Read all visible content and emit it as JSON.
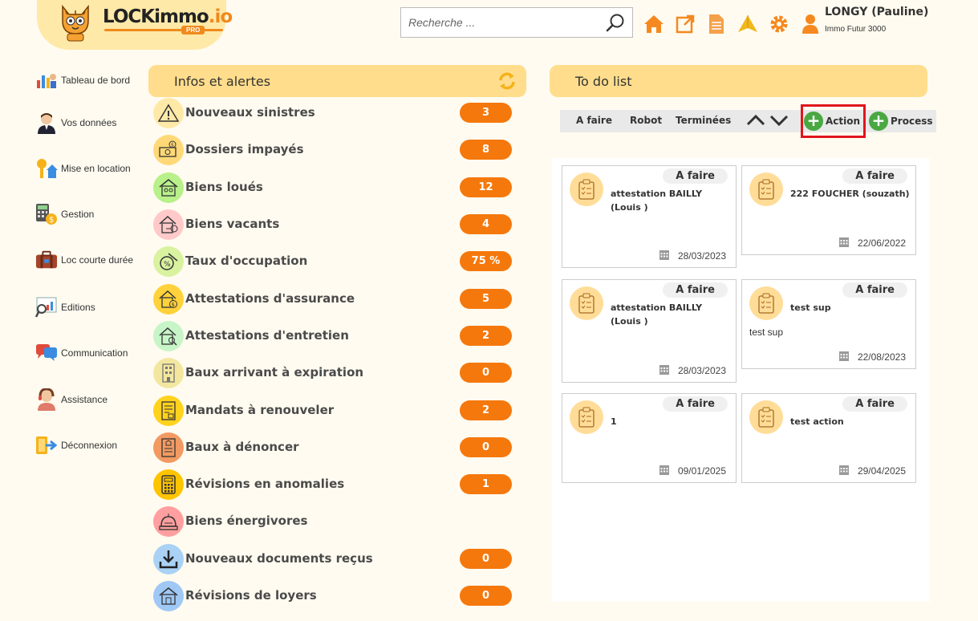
{
  "header": {
    "logo_text": "LOCKimmo",
    "logo_suffix": ".io",
    "logo_badge": "PRO",
    "search_placeholder": "Recherche ...",
    "user_name": "LONGY (Pauline)",
    "user_company": "Immo Futur 3000",
    "icons": [
      "home-icon",
      "external-link-icon",
      "document-icon",
      "paper-plane-icon",
      "gear-icon",
      "user-icon"
    ],
    "accent_color": "#f08a1c"
  },
  "sidebar": {
    "items": [
      {
        "label": "Tableau de bord",
        "icon": "dashboard-icon"
      },
      {
        "label": "Vos données",
        "icon": "person-icon"
      },
      {
        "label": "Mise en location",
        "icon": "key-house-icon"
      },
      {
        "label": "Gestion",
        "icon": "calculator-money-icon"
      },
      {
        "label": "Loc courte durée",
        "icon": "suitcase-icon"
      },
      {
        "label": "Editions",
        "icon": "chart-search-icon"
      },
      {
        "label": "Communication",
        "icon": "chat-bubbles-icon"
      },
      {
        "label": "Assistance",
        "icon": "support-agent-icon"
      },
      {
        "label": "Déconnexion",
        "icon": "logout-icon"
      }
    ]
  },
  "infos": {
    "title": "Infos et alertes",
    "badge_color": "#f5780c",
    "rows": [
      {
        "label": "Nouveaux sinistres",
        "count": "3",
        "icon": "warning-icon",
        "bg": "#ffe9a8"
      },
      {
        "label": "Dossiers impayés",
        "count": "8",
        "icon": "unpaid-icon",
        "bg": "#ffd977"
      },
      {
        "label": "Biens loués",
        "count": "12",
        "icon": "rented-house-icon",
        "bg": "#b8f08a"
      },
      {
        "label": "Biens vacants",
        "count": "4",
        "icon": "vacant-house-icon",
        "bg": "#ffc9c9"
      },
      {
        "label": "Taux d'occupation",
        "count": "75 %",
        "icon": "occupancy-icon",
        "bg": "#d9f2a0"
      },
      {
        "label": "Attestations d'assurance",
        "count": "5",
        "icon": "insurance-house-icon",
        "bg": "#ffd23c"
      },
      {
        "label": "Attestations d'entretien",
        "count": "2",
        "icon": "maintenance-house-icon",
        "bg": "#c8f5c8"
      },
      {
        "label": "Baux arrivant à expiration",
        "count": "0",
        "icon": "building-icon",
        "bg": "#f3e7a0"
      },
      {
        "label": "Mandats à renouveler",
        "count": "2",
        "icon": "mandate-document-icon",
        "bg": "#ffd21e"
      },
      {
        "label": "Baux à dénoncer",
        "count": "0",
        "icon": "lease-document-icon",
        "bg": "#f29a62"
      },
      {
        "label": "Révisions en anomalies",
        "count": "1",
        "icon": "calculator-icon",
        "bg": "#ffc400"
      },
      {
        "label": "Biens énergivores",
        "count": "",
        "icon": "heater-icon",
        "bg": "#ff9f9f"
      },
      {
        "label": "Nouveaux documents reçus",
        "count": "0",
        "icon": "download-icon",
        "bg": "#a9d2f5"
      },
      {
        "label": "Révisions de loyers",
        "count": "0",
        "icon": "house-rent-icon",
        "bg": "#9fc8f5"
      }
    ]
  },
  "todo": {
    "title": "To do list",
    "tabs": [
      "A faire",
      "Robot",
      "Terminées"
    ],
    "action_label": "Action",
    "process_label": "Process",
    "cards": [
      {
        "status": "A faire",
        "title": "attestation BAILLY (Louis )",
        "desc": "",
        "date": "28/03/2023"
      },
      {
        "status": "A faire",
        "title": "222 FOUCHER (souzath)",
        "desc": "",
        "date": "22/06/2022"
      },
      {
        "status": "A faire",
        "title": "attestation BAILLY (Louis )",
        "desc": "",
        "date": "28/03/2023"
      },
      {
        "status": "A faire",
        "title": "test sup",
        "desc": "test sup",
        "date": "22/08/2023"
      },
      {
        "status": "A faire",
        "title": "1",
        "desc": "",
        "date": "09/01/2025"
      },
      {
        "status": "A faire",
        "title": "test action",
        "desc": "",
        "date": "29/04/2025"
      }
    ]
  }
}
